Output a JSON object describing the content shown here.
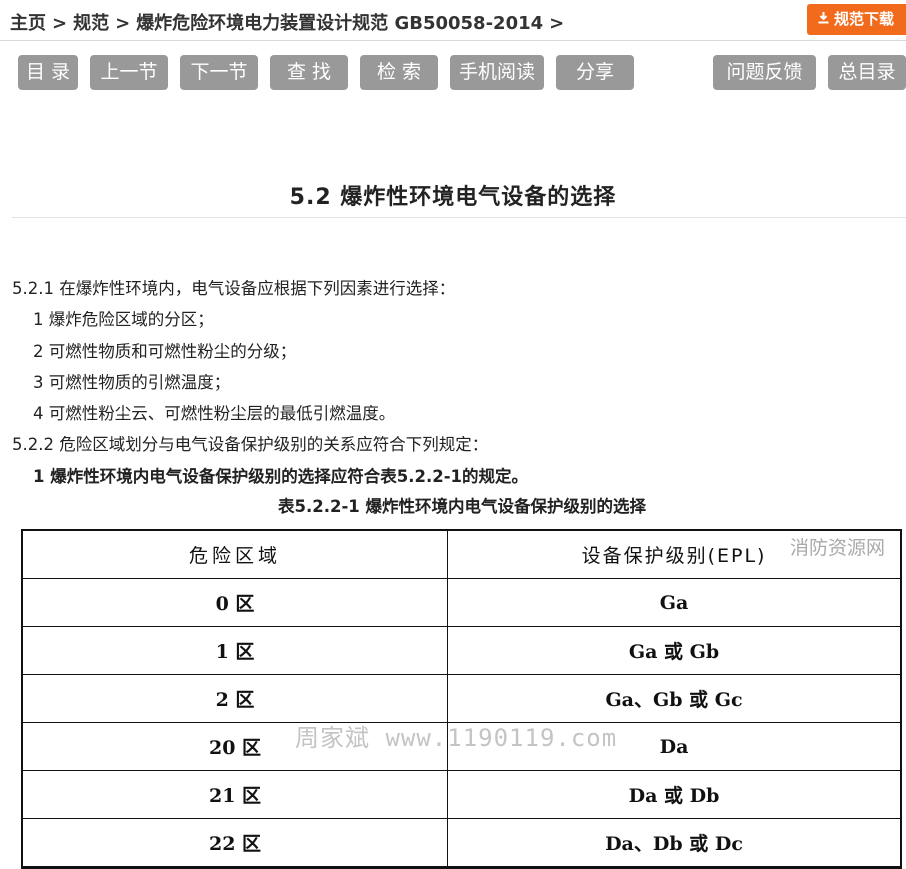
{
  "breadcrumb": {
    "home": "主页",
    "section": "规范",
    "current": "爆炸危险环境电力装置设计规范 GB50058-2014",
    "sep": ">"
  },
  "download_button": {
    "label": "规范下载",
    "icon": "download-icon",
    "color": "#f26b1d"
  },
  "nav_buttons": {
    "toc": "目 录",
    "prev": "上一节",
    "next": "下一节",
    "find": "查 找",
    "search": "检 索",
    "mobile": "手机阅读",
    "share": "分享",
    "feedback": "问题反馈",
    "full_toc": "总目录"
  },
  "section_title": "5.2 爆炸性环境电气设备的选择",
  "paragraphs": {
    "p521": "5.2.1 在爆炸性环境内，电气设备应根据下列因素进行选择：",
    "item1": "1 爆炸危险区域的分区；",
    "item2": "2 可燃性物质和可燃性粉尘的分级；",
    "item3": "3 可燃性物质的引燃温度；",
    "item4": "4 可燃性粉尘云、可燃性粉尘层的最低引燃温度。",
    "p522": "5.2.2 危险区域划分与电气设备保护级别的关系应符合下列规定：",
    "rule1": "1 爆炸性环境内电气设备保护级别的选择应符合表5.2.2-1的规定。"
  },
  "table": {
    "caption": "表5.2.2-1 爆炸性环境内电气设备保护级别的选择",
    "headers": [
      "危险区域",
      "设备保护级别(EPL)"
    ],
    "rows": [
      [
        "0 区",
        "Ga"
      ],
      [
        "1 区",
        "Ga 或 Gb"
      ],
      [
        "2 区",
        "Ga、Gb 或 Gc"
      ],
      [
        "20 区",
        "Da"
      ],
      [
        "21 区",
        "Da 或 Db"
      ],
      [
        "22 区",
        "Da、Db 或 Dc"
      ]
    ]
  },
  "watermarks": {
    "corner": "消防资源网",
    "center": "周家斌 www.1190119.com"
  }
}
